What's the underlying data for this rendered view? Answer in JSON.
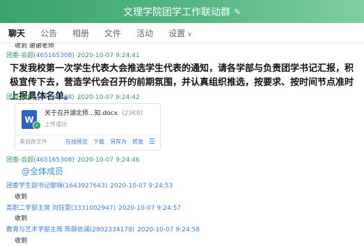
{
  "window": {
    "title": "文理学院团学工作联动群"
  },
  "tabs": [
    {
      "label": "聊天"
    },
    {
      "label": "公告"
    },
    {
      "label": "相册"
    },
    {
      "label": "文件"
    },
    {
      "label": "活动"
    },
    {
      "label": "设置"
    }
  ],
  "messages": {
    "m0": {
      "text": "收到 谢谢老师"
    },
    "m1": {
      "sender": "团委-会超",
      "qq": "(465165308)",
      "time": "2020-10-07 9:24:41",
      "text": "下发我校第一次学生代表大会推选学生代表的通知，请各学部与负责团学书记汇报，积极宣传下去，营造学代会召开的前期氛围，并认真组织推选，按要求、按时间节点准时上报具体名单。"
    },
    "m2": {
      "sender": "团委-会超",
      "qq": "(465165308)",
      "time": "2020-10-07 9:24:42",
      "file": {
        "name": "关于召开湖北师...知.docx",
        "size": "(23KB)",
        "status": "上传成功",
        "source": "来自群文件",
        "actions": [
          "在线预览",
          "下载",
          "另存为",
          "转发"
        ]
      }
    },
    "m3": {
      "sender": "团委-会超",
      "qq": "(465165308)",
      "time": "2020-10-07 9:24:46",
      "text": "@全体成员"
    },
    "m4": {
      "sender": "团委学生副书记黎嗨",
      "qq": "(1643927643)",
      "time": "2020-10-07 9:24:53",
      "text": "收到"
    },
    "m5": {
      "sender": "高职二学部主席 刘钰雯",
      "qq": "(3331002947)",
      "time": "2020-10-07 9:24:57",
      "text": "收到"
    },
    "m6": {
      "sender": "教育与艺术学部主席 陈薛依澜",
      "qq": "(2802334179)",
      "time": "2020-10-07 9:24:58",
      "text": "收到"
    }
  },
  "colors": {
    "titlebar": "#57b784",
    "sender": "#3a9a57",
    "link": "#3b7dd8",
    "mention": "#3b8fd8"
  },
  "icons": {
    "title_edit": "edit-icon",
    "settings_caret": "chevron-down-icon",
    "file": "word-doc-icon",
    "upload_ok": "check-icon",
    "file_menu": "menu-icon"
  }
}
